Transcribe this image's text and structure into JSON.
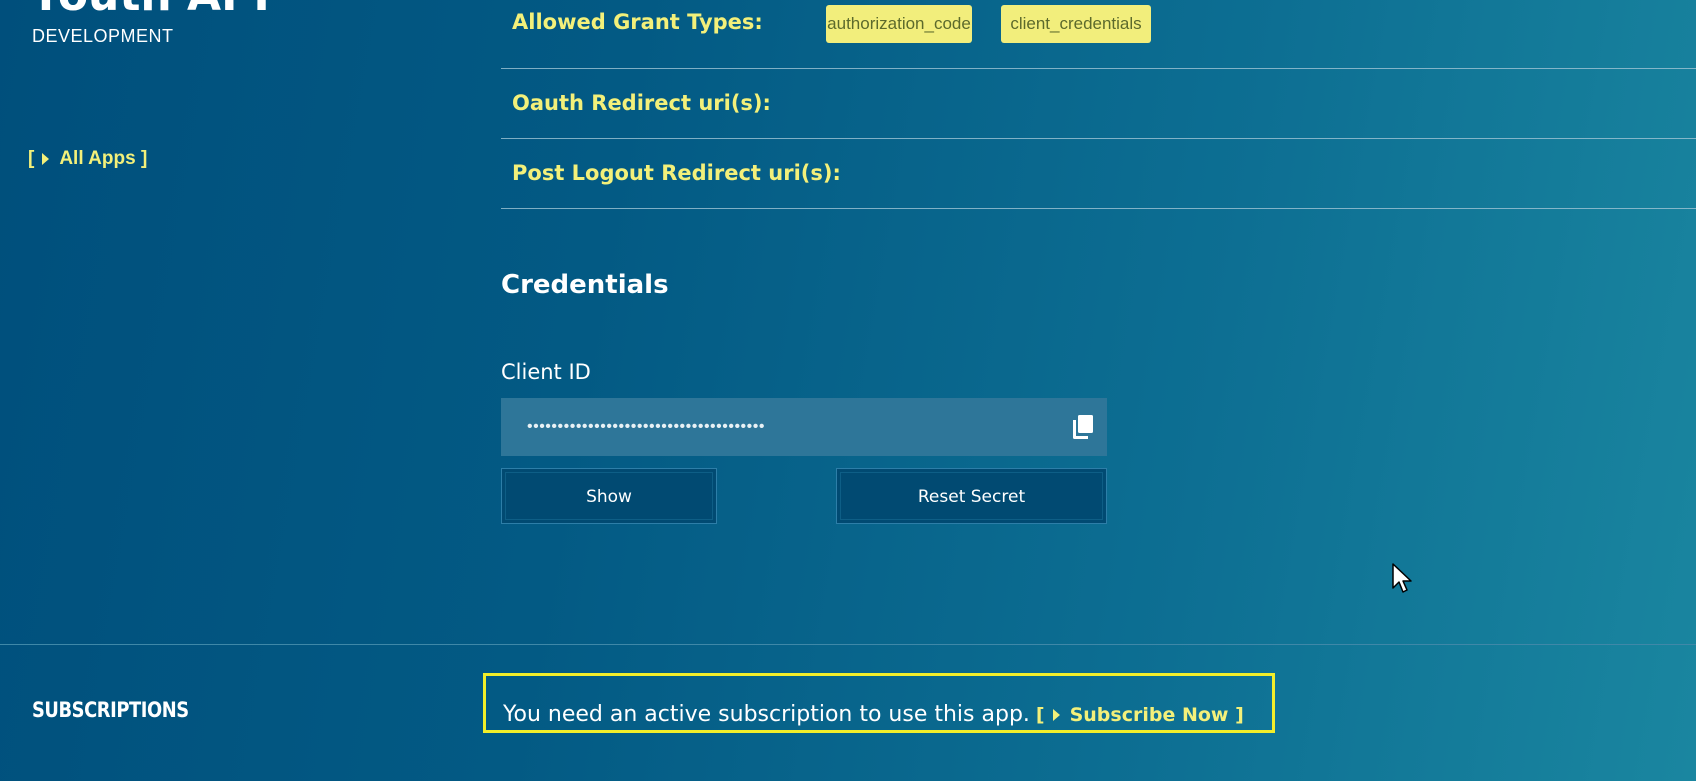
{
  "app": {
    "title": "Youth API",
    "environment": "DEVELOPMENT"
  },
  "nav": {
    "all_apps": "All Apps ]",
    "all_apps_open": "["
  },
  "fields": {
    "grant_types_label": "Allowed Grant Types:",
    "grant_types": [
      "authorization_code",
      "client_credentials"
    ],
    "redirect_label": "Oauth Redirect uri(s):",
    "post_logout_label": "Post Logout Redirect uri(s):"
  },
  "credentials": {
    "heading": "Credentials",
    "client_id_label": "Client ID",
    "client_id_masked": "•••••••••••••••••••••••••••••••••••••••",
    "show_button": "Show",
    "reset_button": "Reset Secret"
  },
  "subscriptions": {
    "title": "SUBSCRIPTIONS",
    "message": "You need an active subscription to use this app.",
    "link_open": "[",
    "link": "Subscribe Now ]"
  },
  "colors": {
    "accent": "#f3f07a",
    "highlight_border": "#f2ee2a",
    "background": "#035a84"
  },
  "icons": {
    "copy": "copy-icon",
    "caret": "caret-right-icon",
    "cursor": "mouse-cursor-icon"
  }
}
